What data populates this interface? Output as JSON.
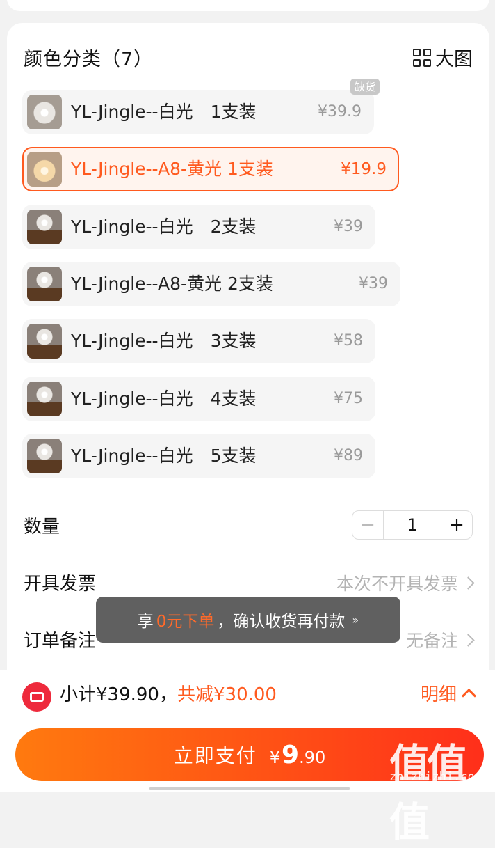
{
  "section": {
    "title": "颜色分类（7）",
    "big_view_label": "大图"
  },
  "options": [
    {
      "name": "YL-Jingle--白光　1支装",
      "price": "¥39.9",
      "badge": "缺货",
      "selected": false,
      "thumb": "white"
    },
    {
      "name": "YL-Jingle--A8-黄光  1支装",
      "price": "¥19.9",
      "badge": "",
      "selected": true,
      "thumb": "yellow"
    },
    {
      "name": "YL-Jingle--白光　2支装",
      "price": "¥39",
      "badge": "",
      "selected": false,
      "thumb": "multi"
    },
    {
      "name": "YL-Jingle--A8-黄光  2支装",
      "price": "¥39",
      "badge": "",
      "selected": false,
      "thumb": "multi"
    },
    {
      "name": "YL-Jingle--白光　3支装",
      "price": "¥58",
      "badge": "",
      "selected": false,
      "thumb": "multi"
    },
    {
      "name": "YL-Jingle--白光　4支装",
      "price": "¥75",
      "badge": "",
      "selected": false,
      "thumb": "multi"
    },
    {
      "name": "YL-Jingle--白光　5支装",
      "price": "¥89",
      "badge": "",
      "selected": false,
      "thumb": "multi"
    }
  ],
  "quantity": {
    "label": "数量",
    "value": "1",
    "minus": "−",
    "plus": "+"
  },
  "invoice": {
    "label": "开具发票",
    "value": "本次不开具发票"
  },
  "remark": {
    "label": "订单备注",
    "value": "无备注"
  },
  "toast": {
    "prefix": "享",
    "highlight": "0元下单",
    "suffix": "，确认收货再付款"
  },
  "summary": {
    "subtotal": "小计¥39.90，",
    "discount": "共减¥30.00",
    "detail_label": "明细"
  },
  "pay": {
    "label": "立即支付",
    "currency": "¥",
    "amount_int": "9",
    "amount_dec": ".90"
  },
  "watermark": {
    "logo_text": "值值值",
    "url": "zhizhizhi.com"
  },
  "colors": {
    "accent": "#ff5a1f",
    "pay_gradient_start": "#ff7a0f",
    "pay_gradient_end": "#ff2f1a",
    "coupon_red": "#ee2a3c"
  }
}
